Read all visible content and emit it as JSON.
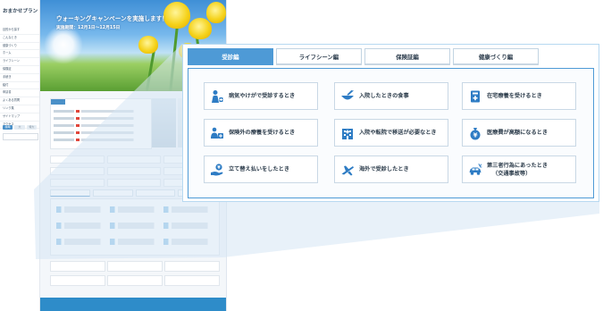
{
  "site": {
    "logo": "おまかせプラン",
    "side_items": [
      "目的から探す",
      "こんなとき",
      "健康づくり",
      "ホーム",
      "ライフシーン",
      "保険証",
      "手続き",
      "給付",
      "申請書",
      "よくある質問",
      "リンク集",
      "サイトマップ",
      "アクセス"
    ],
    "side_buttons": [
      "標準",
      "大",
      "特大"
    ]
  },
  "hero": {
    "title": "ウォーキングキャンペーンを実施します！",
    "period": "実施期間：12月1日～12月15日"
  },
  "panel": {
    "tabs": [
      {
        "label": "受診編",
        "active": true
      },
      {
        "label": "ライフシーン編",
        "active": false
      },
      {
        "label": "保険証編",
        "active": false
      },
      {
        "label": "健康づくり編",
        "active": false
      }
    ],
    "cards": [
      {
        "label": "病気やけがで受診するとき",
        "icon": "doctor-icon"
      },
      {
        "label": "入院したときの食事",
        "icon": "meal-icon"
      },
      {
        "label": "在宅療養を受けるとき",
        "icon": "home-care-icon"
      },
      {
        "label": "保険外の療養を受けるとき",
        "icon": "treatment-icon"
      },
      {
        "label": "入院や転院で移送が必要なとき",
        "icon": "hospital-icon"
      },
      {
        "label": "医療費が高額になるとき",
        "icon": "money-bag-icon"
      },
      {
        "label": "立て替え払いをしたとき",
        "icon": "hand-coin-icon"
      },
      {
        "label": "海外で受診したとき",
        "icon": "airplane-icon"
      },
      {
        "label": "第三者行為にあったとき",
        "label2": "（交通事故等）",
        "icon": "car-accident-icon"
      }
    ]
  },
  "colors": {
    "accent": "#4e9ad6",
    "icon": "#2e7cc4",
    "projection": "#dce9f4"
  }
}
